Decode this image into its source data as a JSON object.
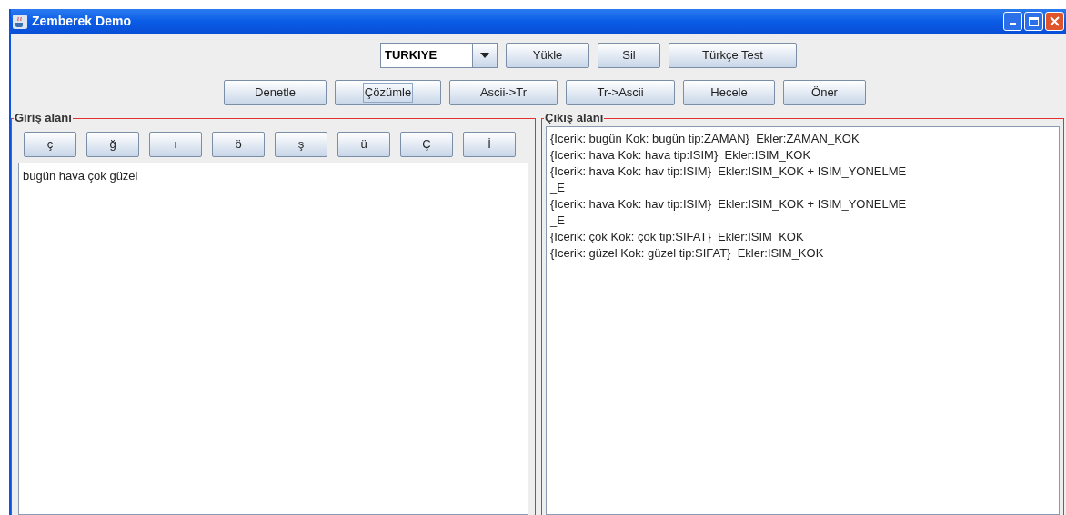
{
  "window": {
    "title": "Zemberek Demo"
  },
  "toolbar_top": {
    "combo": {
      "value": "TURKIYE"
    },
    "buttons": [
      {
        "label": "Yükle",
        "focused": false
      },
      {
        "label": "Sil",
        "focused": false
      },
      {
        "label": "Türkçe Test",
        "focused": false
      }
    ]
  },
  "toolbar_actions": [
    {
      "label": "Denetle",
      "focused": false
    },
    {
      "label": "Çözümle",
      "focused": true
    },
    {
      "label": "Ascii->Tr",
      "focused": false
    },
    {
      "label": "Tr->Ascii",
      "focused": false
    },
    {
      "label": "Hecele",
      "focused": false
    },
    {
      "label": "Öner",
      "focused": false
    }
  ],
  "input_panel": {
    "title": "Giriş alanı",
    "char_buttons": [
      "ç",
      "ğ",
      "ı",
      "ö",
      "ş",
      "ü",
      "Ç",
      "İ"
    ],
    "value": "bugün hava çok güzel"
  },
  "output_panel": {
    "title": "Çıkış alanı",
    "lines": [
      "{Icerik: bugün Kok: bugün tip:ZAMAN}  Ekler:ZAMAN_KOK",
      "{Icerik: hava Kok: hava tip:ISIM}  Ekler:ISIM_KOK",
      "{Icerik: hava Kok: hav tip:ISIM}  Ekler:ISIM_KOK + ISIM_YONELME",
      "_E",
      "{Icerik: hava Kok: hav tip:ISIM}  Ekler:ISIM_KOK + ISIM_YONELME",
      "_E",
      "{Icerik: çok Kok: çok tip:SIFAT}  Ekler:ISIM_KOK",
      "{Icerik: güzel Kok: güzel tip:SIFAT}  Ekler:ISIM_KOK"
    ]
  }
}
